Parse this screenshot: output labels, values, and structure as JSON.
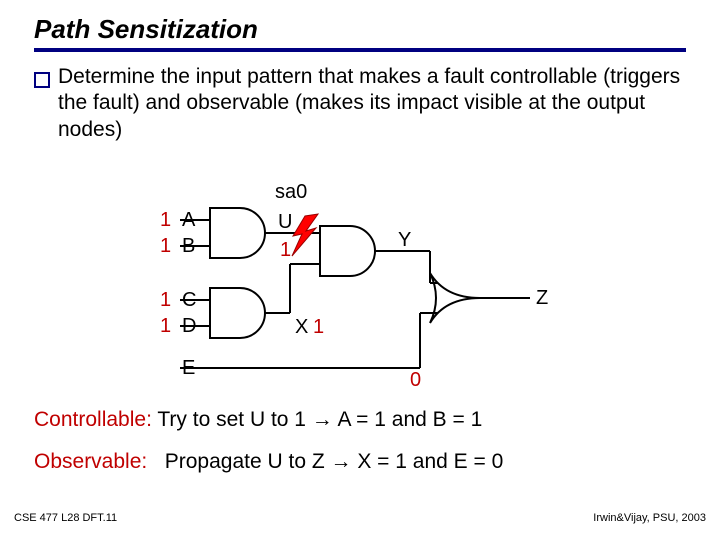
{
  "title": "Path Sensitization",
  "body": "Determine the input pattern that makes a fault controllable (triggers the fault) and observable (makes its impact visible at the output nodes)",
  "diagram": {
    "fault_label": "sa0",
    "inputs": {
      "A": {
        "label": "A",
        "value": "1"
      },
      "B": {
        "label": "B",
        "value": "1"
      },
      "C": {
        "label": "C",
        "value": "1"
      },
      "D": {
        "label": "D",
        "value": "1"
      },
      "E": {
        "label": "E"
      }
    },
    "signals": {
      "U": {
        "label": "U",
        "value": "1"
      },
      "X": {
        "label": "X",
        "value": "1"
      },
      "Y": {
        "label": "Y"
      },
      "Z": {
        "label": "Z"
      },
      "E_val": "0"
    }
  },
  "controllable": {
    "label": "Controllable:",
    "text": "Try to set U to 1 → A = 1 and B = 1"
  },
  "observable": {
    "label": "Observable:",
    "text": "Propagate U to Z → X = 1 and E = 0"
  },
  "footer": {
    "left": "CSE 477   L28 DFT.11",
    "right": "Irwin&Vijay, PSU, 2003"
  }
}
